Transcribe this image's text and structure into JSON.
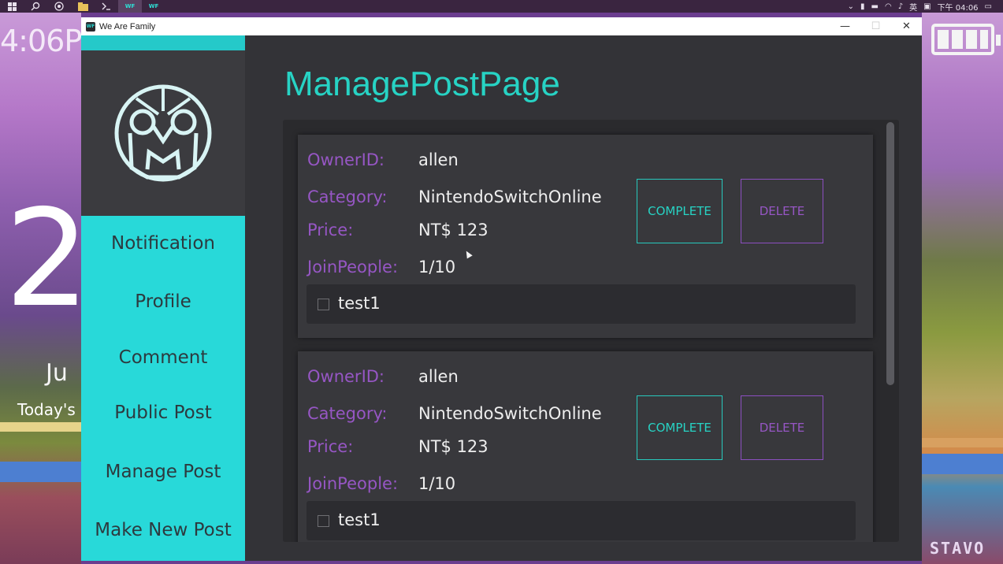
{
  "desktop": {
    "lock_time": "4:06P",
    "lock_day": "2",
    "lock_month": "Ju",
    "lock_today": "Today's",
    "wall_text": "STAVO"
  },
  "taskbar": {
    "tray_time": "下午 04:06",
    "ime_label": "英"
  },
  "window": {
    "title": "We Are Family",
    "icon_label": "WF",
    "minimize": "—",
    "maximize": "☐",
    "close": "✕"
  },
  "sidebar": {
    "items": [
      {
        "label": "Notification"
      },
      {
        "label": "Profile"
      },
      {
        "label": "Comment"
      },
      {
        "label": "Public Post"
      },
      {
        "label": "Manage Post"
      },
      {
        "label": "Make New Post"
      }
    ]
  },
  "main": {
    "page_title": "ManagePostPage",
    "labels": {
      "owner": "OwnerID:",
      "category": "Category:",
      "price": "Price:",
      "join": "JoinPeople:"
    },
    "complete_label": "COMPLETE",
    "delete_label": "DELETE",
    "posts": [
      {
        "owner": "allen",
        "category": "NintendoSwitchOnline",
        "price": "NT$ 123",
        "join_people": "1/10",
        "members": [
          "test1"
        ]
      },
      {
        "owner": "allen",
        "category": "NintendoSwitchOnline",
        "price": "NT$ 123",
        "join_people": "1/10",
        "members": [
          "test1"
        ]
      }
    ]
  }
}
